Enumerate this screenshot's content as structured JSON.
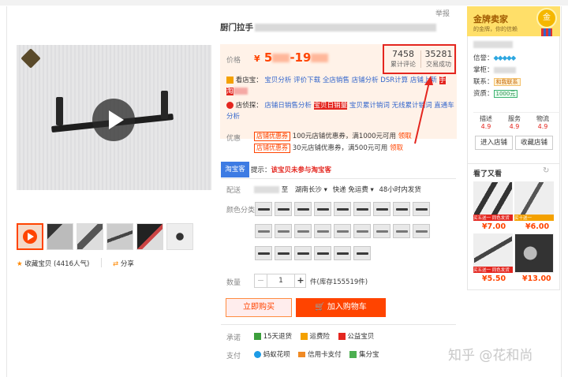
{
  "report": "举报",
  "title": "厨门拉手",
  "price": {
    "label": "价格",
    "symbol": "¥",
    "from": "5",
    "to": "-19"
  },
  "stats": {
    "reviews_count": "7458",
    "reviews_label": "累计评论",
    "deals_count": "35281",
    "deals_label": "交易成功"
  },
  "kandianbao": {
    "label": "看店宝：",
    "links": [
      "宝贝分析",
      "评价下载",
      "全店销售",
      "店铺分析",
      "DSR计算",
      "店铺上新",
      "手",
      "淘"
    ],
    "link_last": "淘"
  },
  "dianxiatan": {
    "label": "店侦探：",
    "links": [
      "店铺日销售分析",
      "宝贝日销量",
      "宝贝累计销词",
      "无线累计销词",
      "直通车分析"
    ]
  },
  "promo": {
    "label": "优惠",
    "items": [
      {
        "tag": "店铺优惠券",
        "text": "100元店铺优惠券，满1000元可用",
        "link": "领取"
      },
      {
        "tag": "店铺优惠券",
        "text": "30元店铺优惠券，满500元可用",
        "link": "领取"
      }
    ]
  },
  "taobao_tab": "淘宝客",
  "tip": {
    "prefix": "提示：",
    "bold": "该宝贝未参与淘宝客"
  },
  "shipping": {
    "label": "配送",
    "to_word": "至",
    "destination": "湖南长沙",
    "express": "快递 免运费",
    "time": "48小时内发货"
  },
  "color_label": "颜色分类",
  "quantity": {
    "label": "数量",
    "value": "1",
    "minus": "−",
    "plus": "+",
    "unit": "件(库存155519件)"
  },
  "buttons": {
    "buy": "立即购买",
    "cart": "加入购物车"
  },
  "promise": {
    "label": "承诺",
    "items": [
      "15天退货",
      "运费险",
      "公益宝贝"
    ]
  },
  "payment": {
    "label": "支付",
    "items": [
      "蚂蚁花呗",
      "信用卡支付",
      "集分宝"
    ]
  },
  "left": {
    "favorite": "收藏宝贝 (4416人气)",
    "share": "分享"
  },
  "sidebar": {
    "gold_title": "金牌卖家",
    "gold_badge": "金",
    "gold_sub": "的金牌，你的信赖",
    "rows": [
      {
        "label": "信誉：",
        "value": "💎💎💎💎💎"
      },
      {
        "label": "掌柜：",
        "value": ""
      },
      {
        "label": "联系：",
        "value": "和我联系"
      },
      {
        "label": "资质：",
        "value": "1000元"
      }
    ],
    "scores": [
      {
        "label": "描述",
        "value": "4.9"
      },
      {
        "label": "服务",
        "value": "4.9"
      },
      {
        "label": "物流",
        "value": "4.9"
      }
    ],
    "enter_store": "进入店铺",
    "fav_store": "收藏店铺"
  },
  "also_viewed": {
    "title": "看了又看",
    "items": [
      {
        "price": "¥7.00",
        "tag": "买五送一 同色发货"
      },
      {
        "price": "¥6.00",
        "tag": "买十送一"
      },
      {
        "price": "¥5.50",
        "tag": "买五送一 同色发货"
      },
      {
        "price": "¥13.00",
        "tag": ""
      }
    ]
  },
  "watermark": "知乎 @花和尚"
}
